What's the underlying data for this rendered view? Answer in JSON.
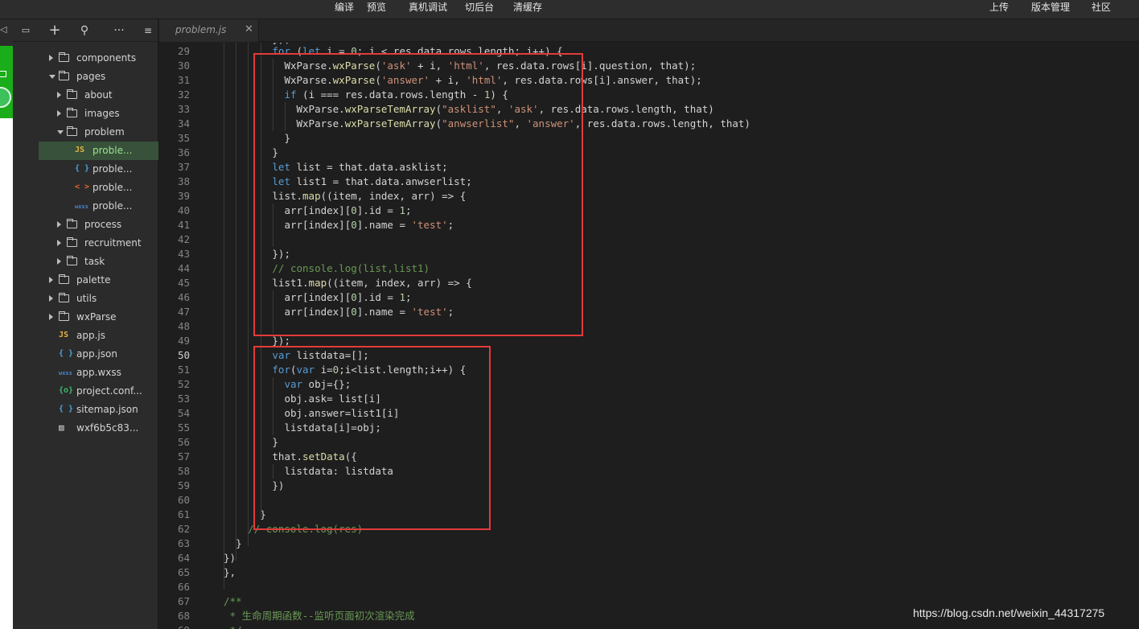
{
  "toolbar": {
    "compile": "编译",
    "preview": "预览",
    "device_debug": "真机调试",
    "background": "切后台",
    "clear_cache": "清缓存",
    "upload": "上传",
    "version": "版本管理",
    "community": "社区"
  },
  "explorer": {
    "items": [
      {
        "label": "components",
        "kind": "folder",
        "state": "collapsed"
      },
      {
        "label": "pages",
        "kind": "folder",
        "state": "expanded"
      },
      {
        "label": "about",
        "kind": "folder",
        "state": "collapsed"
      },
      {
        "label": "images",
        "kind": "folder",
        "state": "collapsed"
      },
      {
        "label": "problem",
        "kind": "folder",
        "state": "expanded"
      },
      {
        "label": "proble...",
        "kind": "js",
        "icon": "JS",
        "selected": true
      },
      {
        "label": "proble...",
        "kind": "json",
        "icon": "{ }"
      },
      {
        "label": "proble...",
        "kind": "wxml",
        "icon": "< >"
      },
      {
        "label": "proble...",
        "kind": "wxss",
        "icon": "wxss"
      },
      {
        "label": "process",
        "kind": "folder",
        "state": "collapsed"
      },
      {
        "label": "recruitment",
        "kind": "folder",
        "state": "collapsed"
      },
      {
        "label": "task",
        "kind": "folder",
        "state": "collapsed"
      },
      {
        "label": "palette",
        "kind": "folder",
        "state": "collapsed"
      },
      {
        "label": "utils",
        "kind": "folder",
        "state": "collapsed"
      },
      {
        "label": "wxParse",
        "kind": "folder",
        "state": "collapsed"
      },
      {
        "label": "app.js",
        "kind": "js",
        "icon": "JS"
      },
      {
        "label": "app.json",
        "kind": "json",
        "icon": "{ }"
      },
      {
        "label": "app.wxss",
        "kind": "wxss",
        "icon": "wxss"
      },
      {
        "label": "project.conf...",
        "kind": "config",
        "icon": "{o}"
      },
      {
        "label": "sitemap.json",
        "kind": "json",
        "icon": "{ }"
      },
      {
        "label": "wxf6b5c83...",
        "kind": "image",
        "icon": "img"
      }
    ]
  },
  "tab": {
    "label": "problem.js"
  },
  "editor": {
    "current_line": 50,
    "lines": [
      {
        "n": 29,
        "html": "<span class=\"k\">for</span> (<span class=\"k\">let</span> i = <span class=\"n\">0</span>; i &lt; res.data.rows.length; i++) {"
      },
      {
        "n": 30,
        "html": "  WxParse.<span class=\"f\">wxParse</span>(<span class=\"s\">'ask'</span> + i, <span class=\"s\">'html'</span>, res.data.rows[i].question, that);"
      },
      {
        "n": 31,
        "html": "  WxParse.<span class=\"f\">wxParse</span>(<span class=\"s\">'answer'</span> + i, <span class=\"s\">'html'</span>, res.data.rows[i].answer, that);"
      },
      {
        "n": 32,
        "html": "  <span class=\"k\">if</span> (i === res.data.rows.length - <span class=\"n\">1</span>) {"
      },
      {
        "n": 33,
        "html": "    WxParse.<span class=\"f\">wxParseTemArray</span>(<span class=\"s\">\"asklist\"</span>, <span class=\"s\">'ask'</span>, res.data.rows.length, that)"
      },
      {
        "n": 34,
        "html": "    WxParse.<span class=\"f\">wxParseTemArray</span>(<span class=\"s\">\"anwserlist\"</span>, <span class=\"s\">'answer'</span>, res.data.rows.length, that)"
      },
      {
        "n": 35,
        "html": "  }"
      },
      {
        "n": 36,
        "html": "}"
      },
      {
        "n": 37,
        "html": "<span class=\"k\">let</span> list = that.data.asklist;"
      },
      {
        "n": 38,
        "html": "<span class=\"k\">let</span> list1 = that.data.anwserlist;"
      },
      {
        "n": 39,
        "html": "list.<span class=\"f\">map</span>((item, index, arr) =&gt; {"
      },
      {
        "n": 40,
        "html": "  arr[index][<span class=\"n\">0</span>].id = <span class=\"n\">1</span>;"
      },
      {
        "n": 41,
        "html": "  arr[index][<span class=\"n\">0</span>].name = <span class=\"s\">'test'</span>;"
      },
      {
        "n": 42,
        "html": ""
      },
      {
        "n": 43,
        "html": "});"
      },
      {
        "n": 44,
        "html": "<span class=\"c\">// console.log(list,list1)</span>"
      },
      {
        "n": 45,
        "html": "list1.<span class=\"f\">map</span>((item, index, arr) =&gt; {"
      },
      {
        "n": 46,
        "html": "  arr[index][<span class=\"n\">0</span>].id = <span class=\"n\">1</span>;"
      },
      {
        "n": 47,
        "html": "  arr[index][<span class=\"n\">0</span>].name = <span class=\"s\">'test'</span>;"
      },
      {
        "n": 48,
        "html": ""
      },
      {
        "n": 49,
        "html": "});"
      },
      {
        "n": 50,
        "html": "<span class=\"k\">var</span> listdata=[];"
      },
      {
        "n": 51,
        "html": "<span class=\"k\">for</span>(<span class=\"k\">var</span> i=<span class=\"n\">0</span>;i&lt;list.length;i++) {"
      },
      {
        "n": 52,
        "html": "  <span class=\"k\">var</span> obj={};"
      },
      {
        "n": 53,
        "html": "  obj.ask= list[i]"
      },
      {
        "n": 54,
        "html": "  obj.answer=list1[i]"
      },
      {
        "n": 55,
        "html": "  listdata[i]=obj;"
      },
      {
        "n": 56,
        "html": "}"
      },
      {
        "n": 57,
        "html": "that.<span class=\"f\">setData</span>({"
      },
      {
        "n": 58,
        "html": "  listdata: listdata"
      },
      {
        "n": 59,
        "html": "})"
      },
      {
        "n": 60,
        "html": ""
      },
      {
        "n": 61,
        "html": "}"
      },
      {
        "n": 62,
        "html": "<span class=\"c\">// console.log(res)</span>"
      },
      {
        "n": 63,
        "html": "}"
      },
      {
        "n": 64,
        "html": "})"
      },
      {
        "n": 65,
        "html": "},"
      },
      {
        "n": 66,
        "html": ""
      },
      {
        "n": 67,
        "html": "<span class=\"c\">/**</span>"
      },
      {
        "n": 68,
        "html": "<span class=\"c\"> * 生命周期函数--监听页面初次渲染完成</span>"
      },
      {
        "n": 69,
        "html": "<span class=\"c\"> */</span>"
      }
    ]
  },
  "watermark": "https://blog.csdn.net/weixin_44317275",
  "colors": {
    "highlight_box": "#e33b3b",
    "selected_file": "#37513a",
    "simulator_green": "#1aad19"
  }
}
